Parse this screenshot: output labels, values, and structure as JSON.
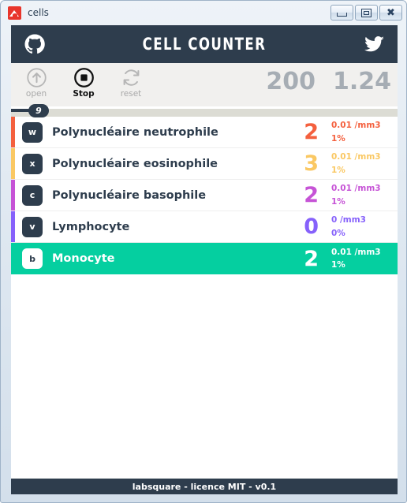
{
  "window": {
    "title": "cells",
    "app_icon": "labsquare-icon",
    "controls": {
      "minimize": "minimize-icon",
      "maximize": "restore-icon",
      "close": "close-icon"
    }
  },
  "banner": {
    "title": "Cell Counter",
    "github_icon": "github-icon",
    "twitter_icon": "twitter-icon",
    "background": "#2e3d4d"
  },
  "toolbar": {
    "buttons": [
      {
        "name": "open",
        "label": "open",
        "icon": "upload-arrow-icon",
        "state": "disabled"
      },
      {
        "name": "stop",
        "label": "Stop",
        "icon": "stop-record-icon",
        "state": "active"
      },
      {
        "name": "reset",
        "label": "reset",
        "icon": "refresh-icon",
        "state": "disabled"
      }
    ],
    "total_label": "200",
    "ratio_label": "1.24"
  },
  "progress": {
    "badge": "9",
    "percent": 9,
    "fill_color": "#2e3d4d",
    "track_color": "#dcdcd4"
  },
  "cells": [
    {
      "key": "w",
      "name": "Polynucléaire neutrophile",
      "count": "2",
      "concentration": "0.01 /mm3",
      "percent": "1%",
      "color": "#f4603e",
      "selected": false
    },
    {
      "key": "x",
      "name": "Polynucléaire eosinophile",
      "count": "3",
      "concentration": "0.01 /mm3",
      "percent": "1%",
      "color": "#fac863",
      "selected": false
    },
    {
      "key": "c",
      "name": "Polynucléaire basophile",
      "count": "2",
      "concentration": "0.01 /mm3",
      "percent": "1%",
      "color": "#c653d6",
      "selected": false
    },
    {
      "key": "v",
      "name": "Lymphocyte",
      "count": "0",
      "concentration": "0 /mm3",
      "percent": "0%",
      "color": "#8661fb",
      "selected": false
    },
    {
      "key": "b",
      "name": "Monocyte",
      "count": "2",
      "concentration": "0.01 /mm3",
      "percent": "1%",
      "color": "#05cfa0",
      "selected": true
    }
  ],
  "footer": {
    "text": "labsquare - licence MIT - v0.1"
  }
}
